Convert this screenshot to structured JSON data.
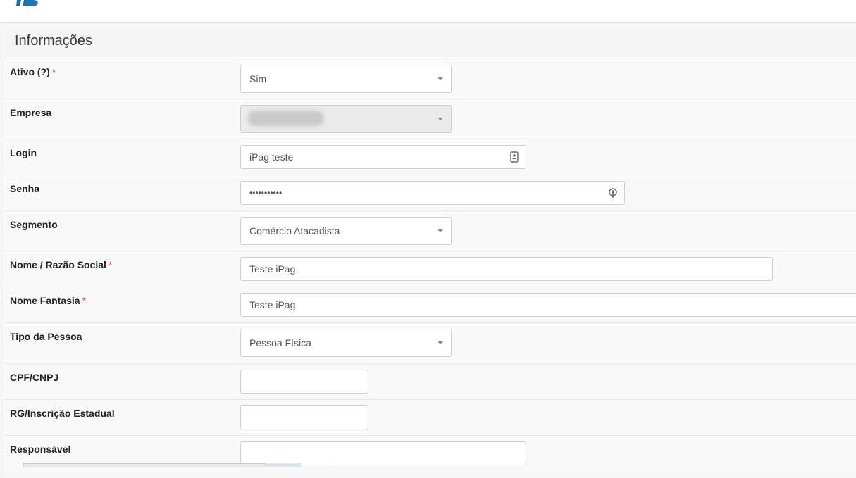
{
  "panel": {
    "title": "Informações"
  },
  "fields": {
    "ativo": {
      "label": "Ativo (?)",
      "required": "*",
      "value": "Sim"
    },
    "empresa": {
      "label": "Empresa"
    },
    "login": {
      "label": "Login",
      "value": "iPag teste"
    },
    "senha": {
      "label": "Senha",
      "value": "•••••••••••"
    },
    "segmento": {
      "label": "Segmento",
      "value": "Comércio Atacadista"
    },
    "nome_razao": {
      "label": "Nome / Razão Social",
      "required": "*",
      "value": "Teste iPag"
    },
    "nome_fantasia": {
      "label": "Nome Fantasia",
      "required": "*",
      "value": "Teste iPag"
    },
    "tipo_pessoa": {
      "label": "Tipo da Pessoa",
      "value": "Pessoa Física"
    },
    "cpf_cnpj": {
      "label": "CPF/CNPJ",
      "value": ""
    },
    "rg_ie": {
      "label": "RG/Inscrição Estadual",
      "value": ""
    },
    "responsavel": {
      "label": "Responsável",
      "value": ""
    }
  },
  "colors": {
    "required": "#d9534f",
    "logo": "#1f6fb5"
  },
  "icons": {
    "select": "chevron-down-icon",
    "login": "contact-card-icon",
    "senha": "key-icon"
  }
}
